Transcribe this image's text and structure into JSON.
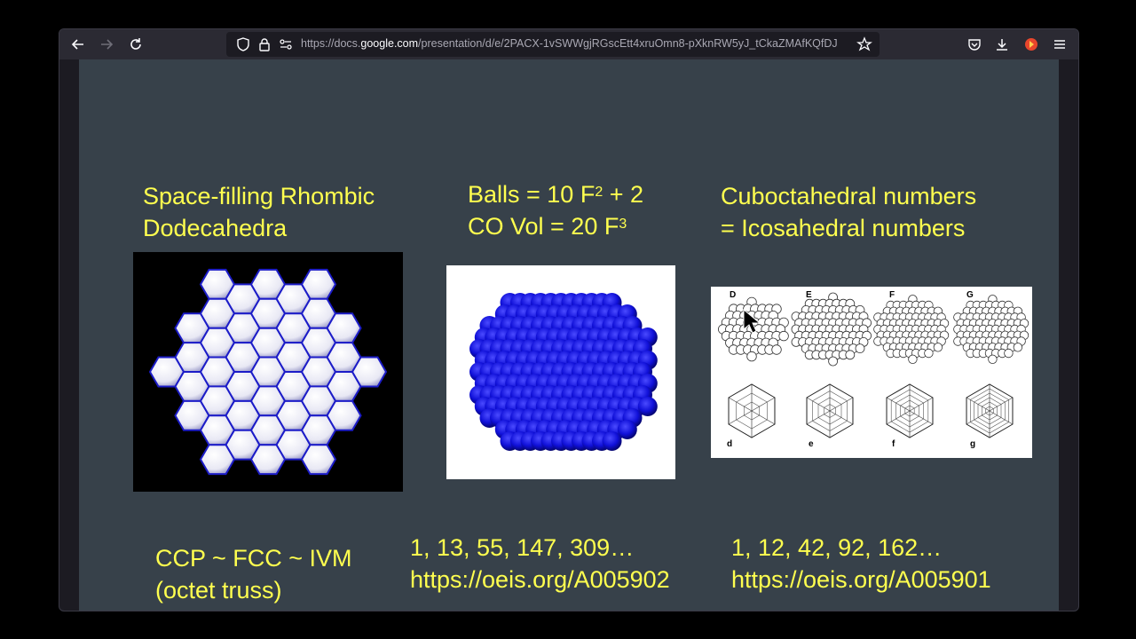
{
  "browser": {
    "url_prefix": "https://docs.",
    "url_domain": "google.com",
    "url_suffix": "/presentation/d/e/2PACX-1vSWWgjRGscEtt4xruOmn8-pXknRW5yJ_tCkaZMAfKQfDJ",
    "icons": [
      "back-icon",
      "forward-icon",
      "reload-icon",
      "shield-icon",
      "lock-icon",
      "permissions-icon",
      "bookmark-star-icon",
      "pocket-icon",
      "download-icon",
      "extension-icon",
      "menu-icon"
    ]
  },
  "slide": {
    "col1_title_line1": "Space-filling Rhombic",
    "col1_title_line2": "Dodecahedra",
    "col2_title_line1_a": "Balls = 10 F",
    "col2_title_line1_sup": "2",
    "col2_title_line1_b": " + 2",
    "col2_title_line2_a": "CO Vol = 20 F",
    "col2_title_line2_sup": "3",
    "col3_title_line1": "Cuboctahedral numbers",
    "col3_title_line2": "= Icosahedral numbers",
    "col1_caption_line1": "CCP ~ FCC ~ IVM",
    "col1_caption_line2": "(octet truss)",
    "col2_caption_line1": "1, 13, 55, 147, 309…",
    "col2_caption_line2": "https://oeis.org/A005902",
    "col3_caption_line1": "1, 12, 42, 92, 162…",
    "col3_caption_line2": "https://oeis.org/A005901",
    "figure_labels_top": [
      "D",
      "E",
      "F",
      "G"
    ],
    "figure_labels_bottom": [
      "d",
      "e",
      "f",
      "g"
    ],
    "text_color": "#ffff4f",
    "background_color": "#37414a"
  }
}
